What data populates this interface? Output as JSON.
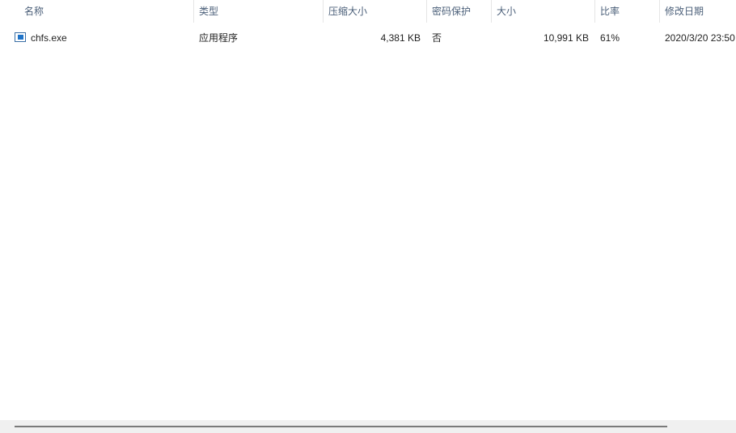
{
  "columns": [
    "名称",
    "类型",
    "压缩大小",
    "密码保护",
    "大小",
    "比率",
    "修改日期"
  ],
  "sort_icon": "chevron-up-icon",
  "files": [
    {
      "name": "chfs.exe",
      "type": "应用程序",
      "packed": "4,381 KB",
      "password": "否",
      "size": "10,991 KB",
      "ratio": "61%",
      "modified": "2020/3/20 23:50",
      "icon": "exe-icon"
    }
  ]
}
